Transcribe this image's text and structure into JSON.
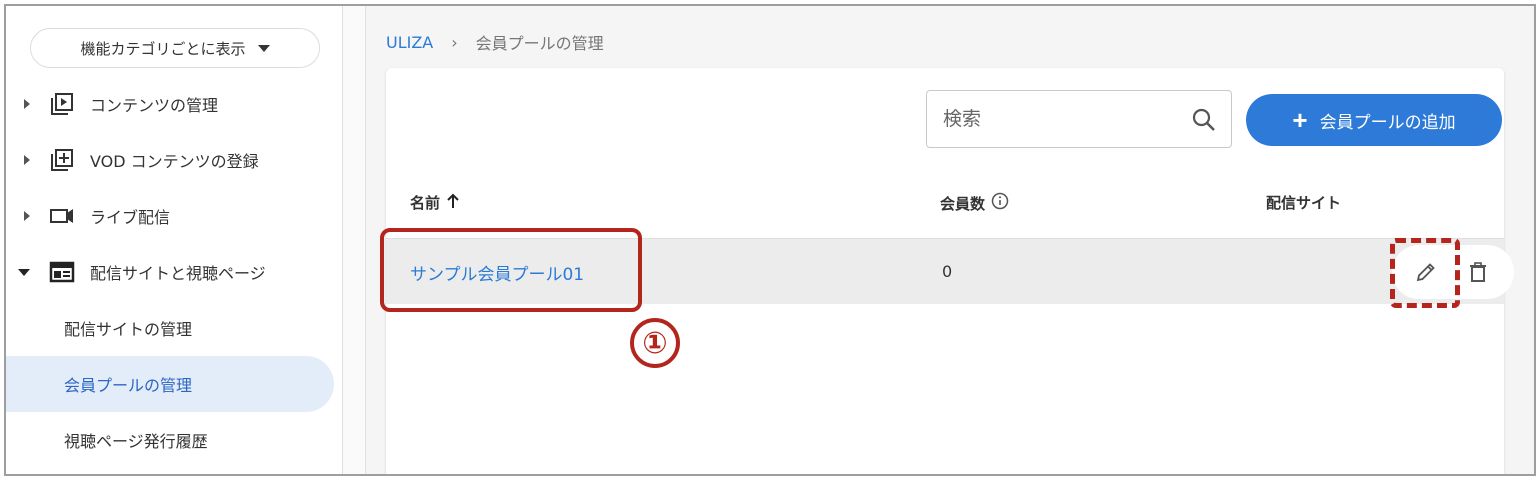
{
  "sidebar": {
    "category_select": "機能カテゴリごとに表示",
    "items": [
      {
        "label": "コンテンツの管理",
        "icon": "play-library-icon",
        "expanded": false
      },
      {
        "label": "VOD コンテンツの登録",
        "icon": "add-library-icon",
        "expanded": false
      },
      {
        "label": "ライブ配信",
        "icon": "video-camera-icon",
        "expanded": false
      },
      {
        "label": "配信サイトと視聴ページ",
        "icon": "web-page-icon",
        "expanded": true
      }
    ],
    "sub_items": [
      {
        "label": "配信サイトの管理",
        "active": false
      },
      {
        "label": "会員プールの管理",
        "active": true
      },
      {
        "label": "視聴ページ発行履歴",
        "active": false
      }
    ]
  },
  "breadcrumb": {
    "home": "ULIZA",
    "separator": "›",
    "current": "会員プールの管理"
  },
  "toolbar": {
    "search_placeholder": "検索",
    "add_label": "会員プールの追加"
  },
  "table": {
    "headers": {
      "name": "名前",
      "members": "会員数",
      "site": "配信サイト"
    },
    "rows": [
      {
        "name": "サンプル会員プール01",
        "members": "0",
        "site": ""
      }
    ]
  },
  "annotation": {
    "number": "①",
    "color": "#b3261e"
  },
  "colors": {
    "accent": "#2d7ad8",
    "link": "#2b7bd6",
    "active_bg": "#e3ecf9"
  }
}
